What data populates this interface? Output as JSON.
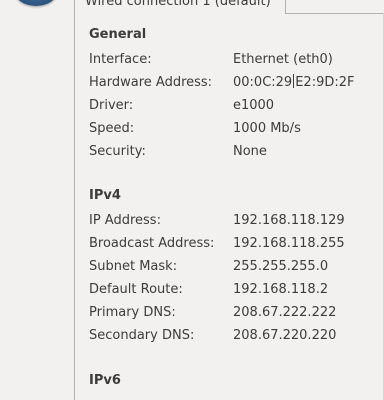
{
  "tab": {
    "label": "Wired connection 1 (default)"
  },
  "general": {
    "title": "General",
    "rows": [
      {
        "label": "Interface:",
        "value": "Ethernet (eth0)"
      },
      {
        "label": "Hardware Address:",
        "value_before_cursor": "00:0C:29",
        "value_after_cursor": "E2:9D:2F"
      },
      {
        "label": "Driver:",
        "value": "e1000"
      },
      {
        "label": "Speed:",
        "value": "1000 Mb/s"
      },
      {
        "label": "Security:",
        "value": "None"
      }
    ]
  },
  "ipv4": {
    "title": "IPv4",
    "rows": [
      {
        "label": "IP Address:",
        "value": "192.168.118.129"
      },
      {
        "label": "Broadcast Address:",
        "value": "192.168.118.255"
      },
      {
        "label": "Subnet Mask:",
        "value": "255.255.255.0"
      },
      {
        "label": "Default Route:",
        "value": "192.168.118.2"
      },
      {
        "label": "Primary DNS:",
        "value": "208.67.222.222"
      },
      {
        "label": "Secondary DNS:",
        "value": "208.67.220.220"
      }
    ]
  },
  "ipv6": {
    "title": "IPv6"
  },
  "icons": {
    "top_left": "network-app-icon"
  }
}
